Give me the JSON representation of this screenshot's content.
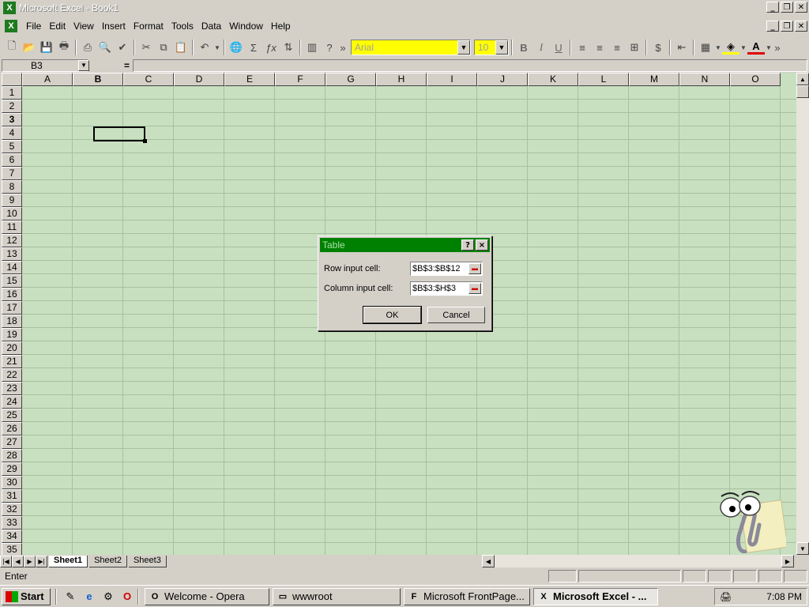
{
  "window": {
    "title": "Microsoft Excel - Book1",
    "app_icon": "X"
  },
  "menu": {
    "items": [
      "File",
      "Edit",
      "View",
      "Insert",
      "Format",
      "Tools",
      "Data",
      "Window",
      "Help"
    ],
    "underlines": [
      "F",
      "E",
      "V",
      "I",
      "o",
      "T",
      "D",
      "W",
      "H"
    ]
  },
  "toolbar": {
    "font_name": "Arial",
    "font_size": "10",
    "bold": "B",
    "italic": "I",
    "underline": "U"
  },
  "formula_bar": {
    "name_box": "B3",
    "equals": "="
  },
  "grid": {
    "columns": [
      "A",
      "B",
      "C",
      "D",
      "E",
      "F",
      "G",
      "H",
      "I",
      "J",
      "K",
      "L",
      "M",
      "N",
      "O"
    ],
    "rows": [
      "1",
      "2",
      "3",
      "4",
      "5",
      "6",
      "7",
      "8",
      "9",
      "10",
      "11",
      "12",
      "13",
      "14",
      "15",
      "16",
      "17",
      "18",
      "19",
      "20",
      "21",
      "22",
      "23",
      "24",
      "25",
      "26",
      "27",
      "28",
      "29",
      "30",
      "31",
      "32",
      "33",
      "34",
      "35"
    ],
    "selected_column": "B",
    "selected_row": "3"
  },
  "sheets": {
    "tabs": [
      "Sheet1",
      "Sheet2",
      "Sheet3"
    ],
    "active": "Sheet1"
  },
  "status": {
    "text": "Enter"
  },
  "dialog": {
    "title": "Table",
    "help": "?",
    "close": "×",
    "row_label": "Row input cell:",
    "row_value": "$B$3:$B$12",
    "col_label": "Column input cell:",
    "col_value": "$B$3:$H$3",
    "ok": "OK",
    "cancel": "Cancel"
  },
  "taskbar": {
    "start": "Start",
    "tasks": [
      {
        "label": "Welcome - Opera",
        "icon": "O"
      },
      {
        "label": "wwwroot",
        "icon": "▭"
      },
      {
        "label": "Microsoft FrontPage...",
        "icon": "F"
      },
      {
        "label": "Microsoft Excel - ...",
        "icon": "X"
      }
    ],
    "clock": "7:08 PM"
  },
  "colors": {
    "grid_bg": "#c8e0c0",
    "dialog_title": "#008000",
    "font_box": "#ffff00"
  }
}
